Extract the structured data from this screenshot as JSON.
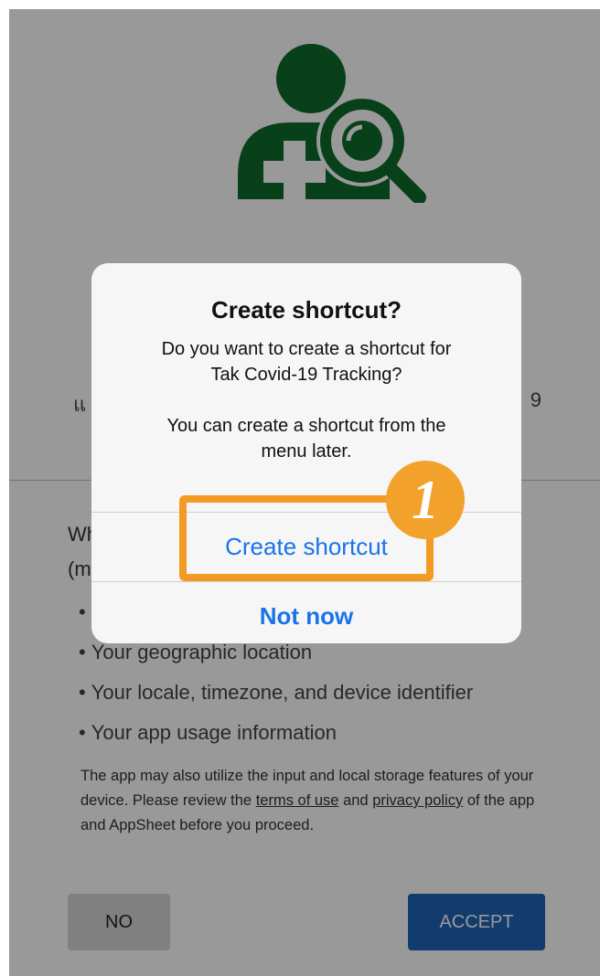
{
  "app": {
    "subtitle_left": "แ",
    "subtitle_right": "9"
  },
  "consent": {
    "intro_line1": "Wh",
    "intro_line2": "(m",
    "bullet_symbol": "•",
    "bullets": [
      "",
      "Your geographic location",
      "Your locale, timezone, and device identifier",
      "Your app usage information"
    ],
    "notice_part1": "The app may also utilize the input and local storage features of your device. Please review the ",
    "terms_link": "terms of use",
    "notice_part2": " and ",
    "privacy_link": "privacy policy",
    "notice_part3": " of the app and AppSheet before you proceed.",
    "no_label": "NO",
    "accept_label": "ACCEPT"
  },
  "dialog": {
    "title": "Create shortcut?",
    "message_line1": "Do you want to create a shortcut for",
    "message_line2": "Tak Covid-19 Tracking?",
    "message_line3": "You can create a shortcut from the",
    "message_line4": "menu later.",
    "create_label": "Create shortcut",
    "notnow_label": "Not now"
  },
  "annotation": {
    "step_number": "1",
    "color": "#f39a25"
  },
  "colors": {
    "logo_green": "#0e6b2c",
    "accept_blue": "#1e64b8",
    "dialog_link_blue": "#1a73e8"
  },
  "icons": {
    "logo": "person-medical-search-icon"
  }
}
